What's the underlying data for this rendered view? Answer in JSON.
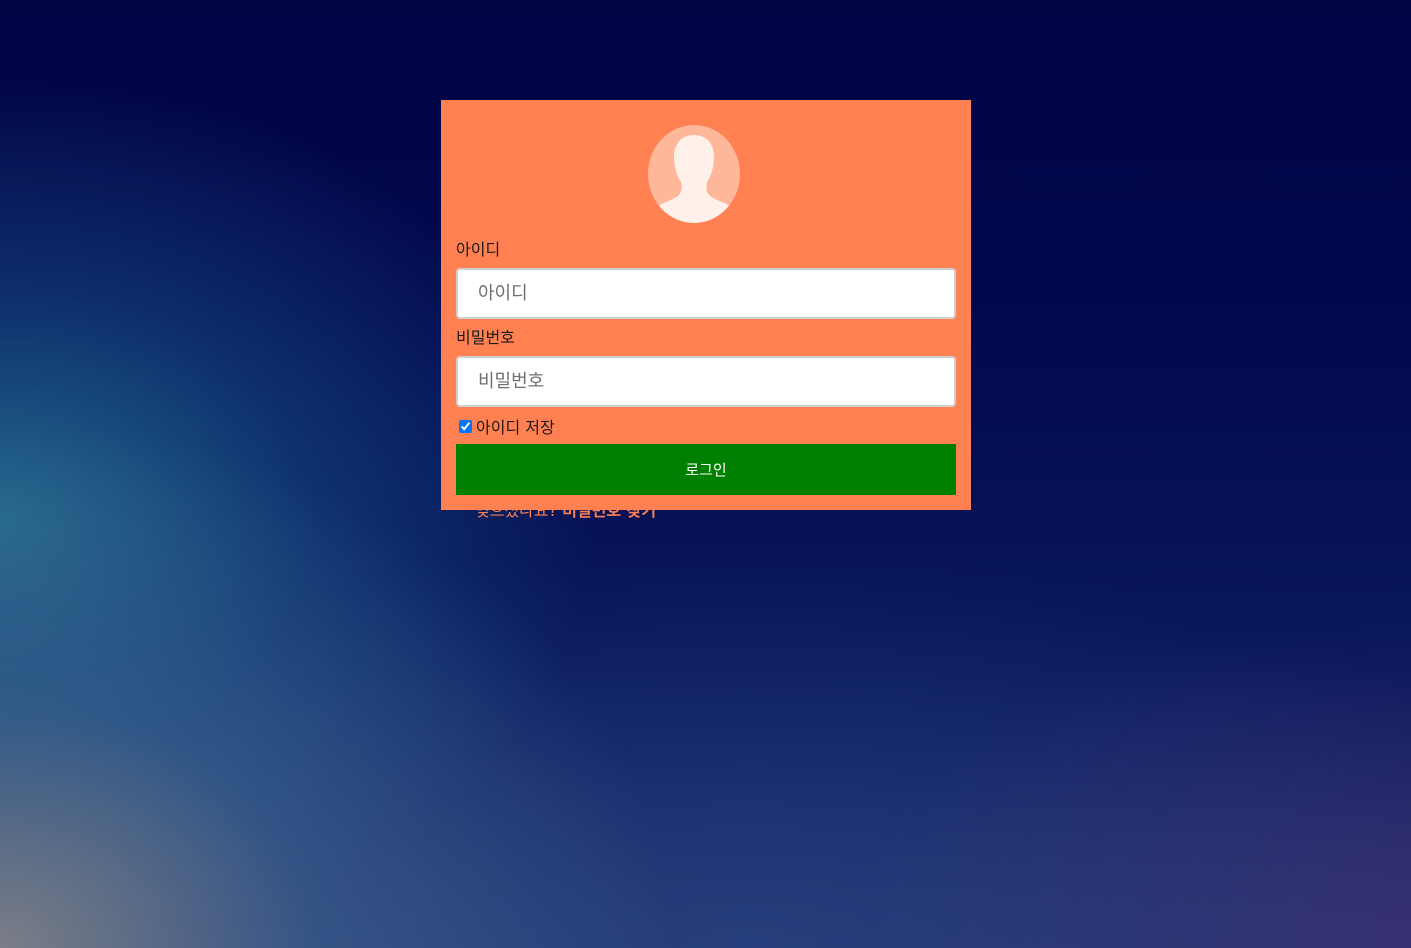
{
  "login": {
    "id_label": "아이디",
    "id_placeholder": "아이디",
    "pw_label": "비밀번호",
    "pw_placeholder": "비밀번호",
    "remember_label": "아이디 저장",
    "remember_checked": true,
    "submit_label": "로그인",
    "forgot_prefix": "잊으셨나요?",
    "forgot_link": "비밀번호 찾기"
  },
  "colors": {
    "card": "#ff8050",
    "button": "#008000",
    "avatar_bg": "#ffb79a",
    "avatar_figure": "#fff0ea"
  },
  "icons": {
    "avatar": "user-silhouette-icon"
  }
}
